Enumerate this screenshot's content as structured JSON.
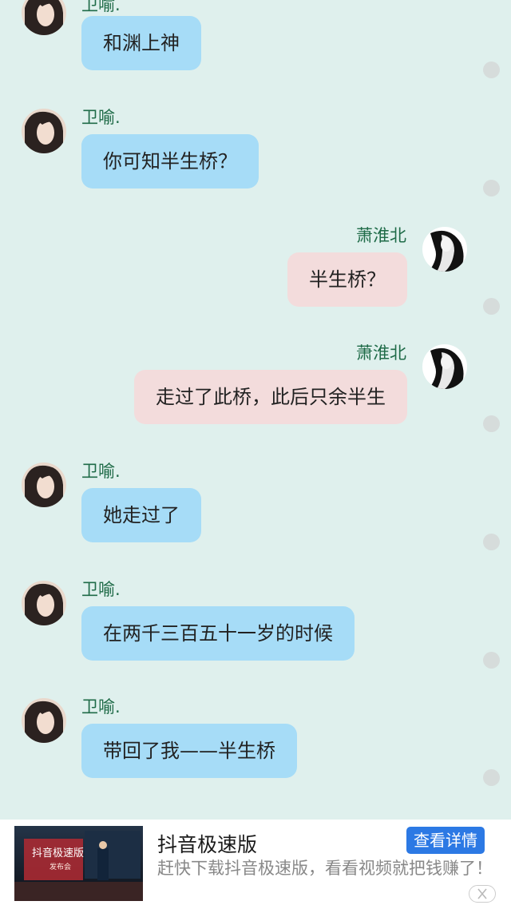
{
  "messages": [
    {
      "side": "left",
      "sender": "卫喻.",
      "text": "和渊上神"
    },
    {
      "side": "left",
      "sender": "卫喻.",
      "text": "你可知半生桥？"
    },
    {
      "side": "right",
      "sender": "萧淮北",
      "text": "半生桥？"
    },
    {
      "side": "right",
      "sender": "萧淮北",
      "text": "走过了此桥，此后只余半生"
    },
    {
      "side": "left",
      "sender": "卫喻.",
      "text": "她走过了"
    },
    {
      "side": "left",
      "sender": "卫喻.",
      "text": "在两千三百五十一岁的时候"
    },
    {
      "side": "left",
      "sender": "卫喻.",
      "text": "带回了我——半生桥"
    }
  ],
  "ad": {
    "title": "抖音极速版",
    "description": "赶快下载抖音极速版，看看视频就把钱赚了！",
    "button_label": "查看详情",
    "thumbnail_caption": "抖音极速版",
    "thumbnail_subcaption": "发布会"
  },
  "colors": {
    "background": "#dff0ed",
    "left_bubble": "#a6dcf7",
    "right_bubble": "#f3dcdc",
    "sender_name": "#1f6b48",
    "ad_button": "#2c79e4"
  }
}
